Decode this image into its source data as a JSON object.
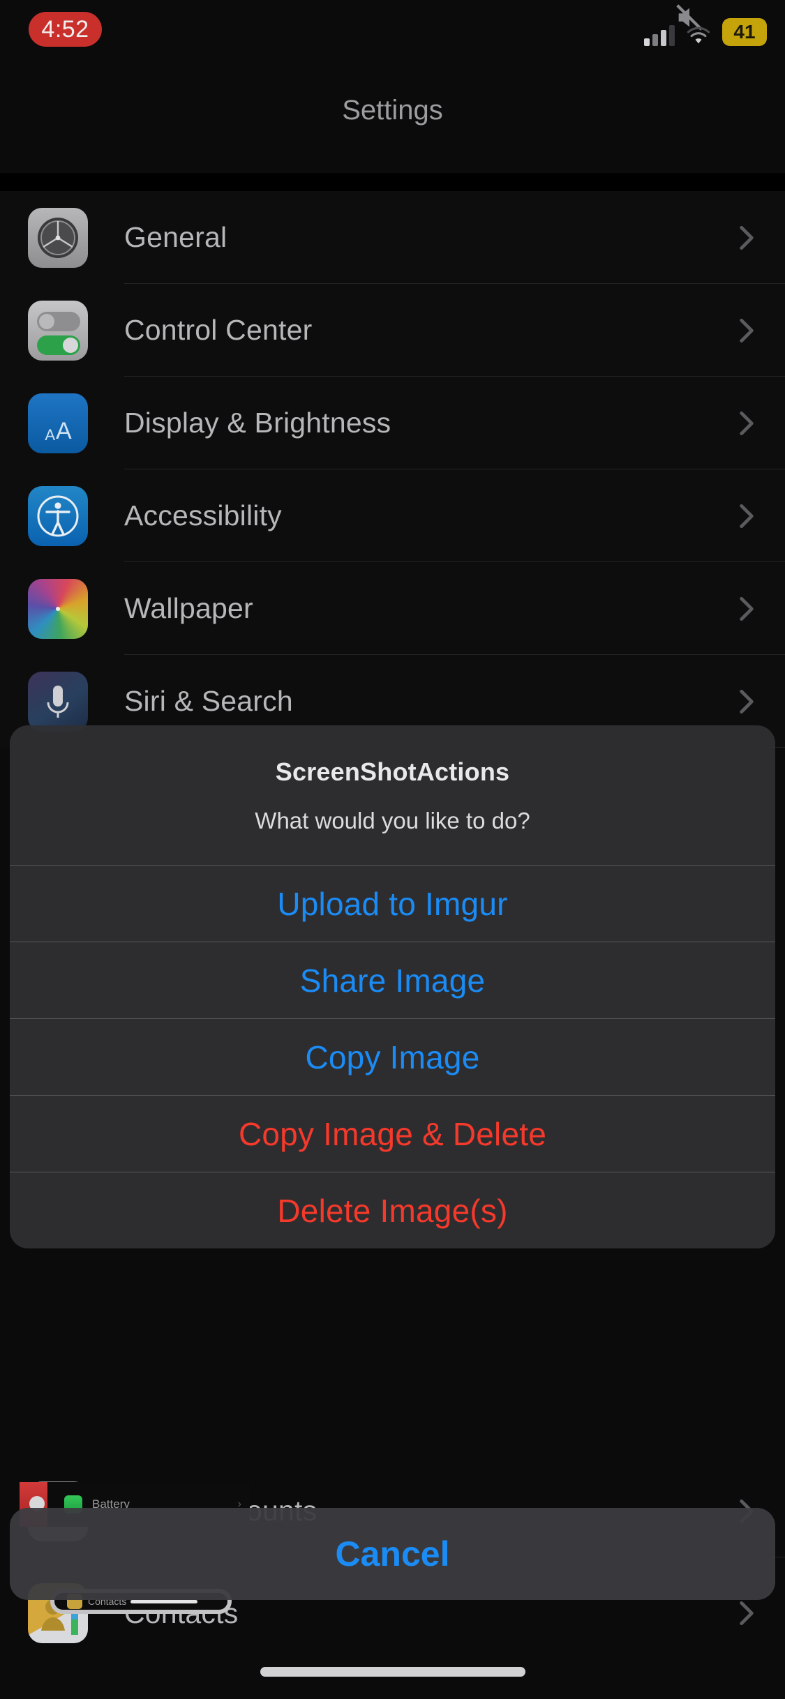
{
  "status_bar": {
    "time": "4:52",
    "time_pill_color": "#c9302c",
    "mute_icon": "speaker-mute-icon",
    "signal_icon": "cellular-bars-icon",
    "wifi_icon": "wifi-icon",
    "battery_level": "41",
    "battery_pill_color": "#c5a30b"
  },
  "nav": {
    "title": "Settings"
  },
  "settings_list": {
    "rows": [
      {
        "label": "General",
        "icon": "gear-icon",
        "chevron": "chevron-right-icon"
      },
      {
        "label": "Control Center",
        "icon": "toggles-icon",
        "chevron": "chevron-right-icon"
      },
      {
        "label": "Display & Brightness",
        "icon": "text-size-icon",
        "chevron": "chevron-right-icon"
      },
      {
        "label": "Accessibility",
        "icon": "accessibility-icon",
        "chevron": "chevron-right-icon"
      },
      {
        "label": "Wallpaper",
        "icon": "wallpaper-flower-icon",
        "chevron": "chevron-right-icon"
      },
      {
        "label": "Siri & Search",
        "icon": "microphone-icon",
        "chevron": "chevron-right-icon"
      }
    ],
    "background_rows": [
      {
        "label": "rds & Accounts",
        "icon": "accounts-icon",
        "chevron": "chevron-right-icon"
      },
      {
        "label": "Contacts",
        "icon": "contacts-icon",
        "chevron": "chevron-right-icon"
      }
    ],
    "nested_artifact": {
      "battery_label": "Battery",
      "contacts_label": "Contacts"
    }
  },
  "action_sheet": {
    "title": "ScreenShotActions",
    "message": "What would you like to do?",
    "accent_blue": "#1b8cf5",
    "accent_red": "#f5392b",
    "actions": [
      {
        "label": "Upload to Imgur",
        "style": "default"
      },
      {
        "label": "Share Image",
        "style": "default"
      },
      {
        "label": "Copy Image",
        "style": "default"
      },
      {
        "label": "Copy Image & Delete",
        "style": "destructive"
      },
      {
        "label": "Delete Image(s)",
        "style": "destructive"
      }
    ],
    "cancel_label": "Cancel"
  }
}
